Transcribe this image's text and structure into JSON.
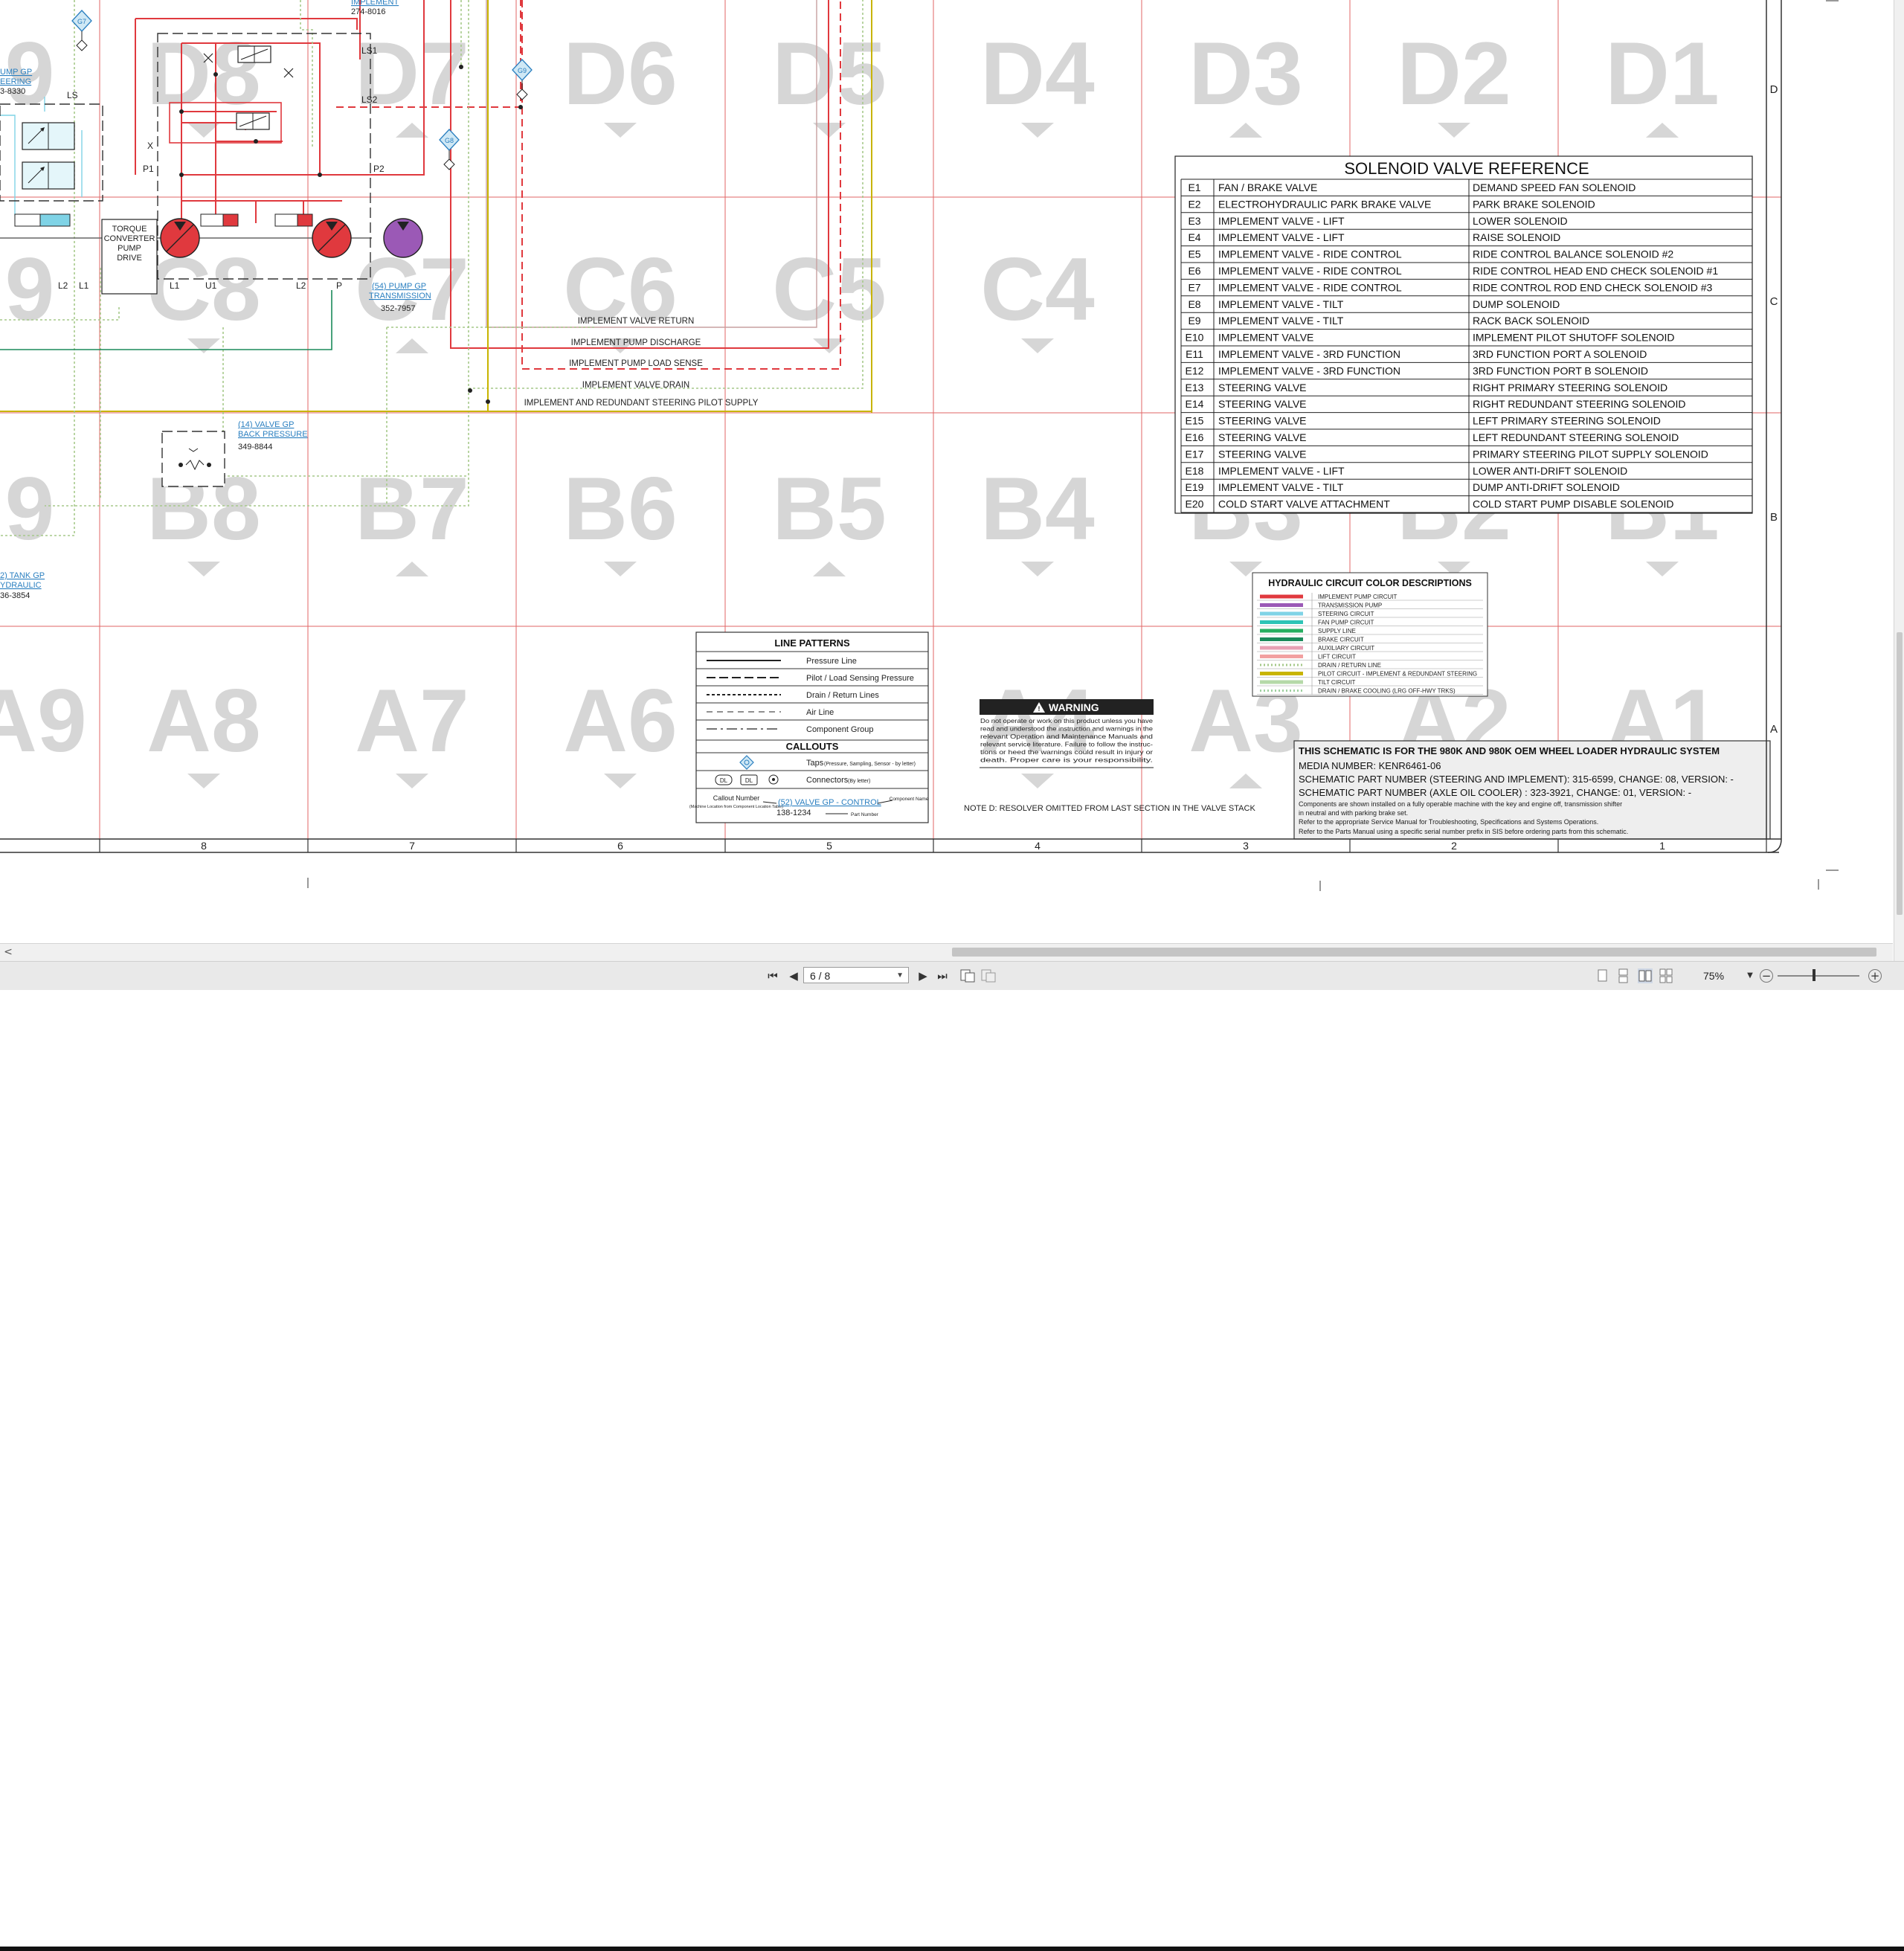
{
  "grid": {
    "zones_d": [
      "D8",
      "D7",
      "D6",
      "D5",
      "D4",
      "D3",
      "D2",
      "D1"
    ],
    "zones_c": [
      "C8",
      "C7",
      "C6",
      "C5",
      "C4",
      "C3",
      "C2",
      "C1"
    ],
    "zones_b": [
      "B8",
      "B7",
      "B6",
      "B5",
      "B4",
      "B3",
      "B2",
      "B1"
    ],
    "zones_a": [
      "A8",
      "A7",
      "A6",
      "A5",
      "A4",
      "A3",
      "A2",
      "A1"
    ],
    "partial_zone_left": [
      "9",
      "9",
      "9",
      "A9"
    ],
    "column_numbers": [
      "8",
      "7",
      "6",
      "5",
      "4",
      "3",
      "2",
      "1"
    ],
    "row_letters": [
      "D",
      "C",
      "B",
      "A"
    ]
  },
  "components": {
    "implement_link": "IMPLEMENT",
    "implement_part": "274-8016",
    "pump_steering_link_1": "UMP GP",
    "pump_steering_link_2": "EERING",
    "pump_steering_part": "3-8330",
    "torque_converter": [
      "TORQUE",
      "CONVERTER",
      "PUMP",
      "DRIVE"
    ],
    "pump_transmission_link_1": "(54) PUMP GP",
    "pump_transmission_link_2": "TRANSMISSION",
    "pump_transmission_part": "352-7957",
    "valve_back_pressure_link_1": "(14) VALVE GP",
    "valve_back_pressure_link_2": "BACK PRESSURE",
    "valve_back_pressure_part": "349-8844",
    "tank_link_1": "2) TANK GP",
    "tank_link_2": "YDRAULIC",
    "tank_part": "36-3854",
    "port_labels": [
      "LS1",
      "LS2",
      "X",
      "P1",
      "P2",
      "LS",
      "L2",
      "L1",
      "U1",
      "L1",
      "L2",
      "P"
    ],
    "tap_labels": [
      "G7",
      "G9",
      "G8"
    ]
  },
  "line_labels": [
    "IMPLEMENT VALVE RETURN",
    "IMPLEMENT PUMP DISCHARGE",
    "IMPLEMENT PUMP LOAD SENSE",
    "IMPLEMENT VALVE DRAIN",
    "IMPLEMENT AND REDUNDANT STEERING PILOT SUPPLY"
  ],
  "solenoid_table": {
    "title": "SOLENOID VALVE REFERENCE",
    "rows": [
      [
        "E1",
        "FAN / BRAKE VALVE",
        "DEMAND SPEED FAN SOLENOID"
      ],
      [
        "E2",
        "ELECTROHYDRAULIC PARK BRAKE VALVE",
        "PARK BRAKE SOLENOID"
      ],
      [
        "E3",
        "IMPLEMENT VALVE - LIFT",
        "LOWER SOLENOID"
      ],
      [
        "E4",
        "IMPLEMENT VALVE - LIFT",
        "RAISE SOLENOID"
      ],
      [
        "E5",
        "IMPLEMENT VALVE - RIDE CONTROL",
        "RIDE CONTROL BALANCE SOLENOID #2"
      ],
      [
        "E6",
        "IMPLEMENT VALVE - RIDE CONTROL",
        "RIDE CONTROL HEAD END CHECK SOLENOID #1"
      ],
      [
        "E7",
        "IMPLEMENT VALVE - RIDE CONTROL",
        "RIDE CONTROL ROD END CHECK SOLENOID #3"
      ],
      [
        "E8",
        "IMPLEMENT VALVE - TILT",
        "DUMP SOLENOID"
      ],
      [
        "E9",
        "IMPLEMENT VALVE - TILT",
        "RACK BACK SOLENOID"
      ],
      [
        "E10",
        "IMPLEMENT VALVE",
        "IMPLEMENT PILOT SHUTOFF SOLENOID"
      ],
      [
        "E11",
        "IMPLEMENT VALVE - 3RD FUNCTION",
        "3RD FUNCTION PORT A SOLENOID"
      ],
      [
        "E12",
        "IMPLEMENT VALVE - 3RD FUNCTION",
        "3RD FUNCTION PORT B SOLENOID"
      ],
      [
        "E13",
        "STEERING VALVE",
        "RIGHT PRIMARY STEERING SOLENOID"
      ],
      [
        "E14",
        "STEERING VALVE",
        "RIGHT REDUNDANT STEERING SOLENOID"
      ],
      [
        "E15",
        "STEERING VALVE",
        "LEFT PRIMARY STEERING SOLENOID"
      ],
      [
        "E16",
        "STEERING VALVE",
        "LEFT REDUNDANT STEERING SOLENOID"
      ],
      [
        "E17",
        "STEERING VALVE",
        "PRIMARY STEERING PILOT SUPPLY SOLENOID"
      ],
      [
        "E18",
        "IMPLEMENT VALVE - LIFT",
        "LOWER ANTI-DRIFT SOLENOID"
      ],
      [
        "E19",
        "IMPLEMENT VALVE - TILT",
        "DUMP ANTI-DRIFT SOLENOID"
      ],
      [
        "E20",
        "COLD START VALVE ATTACHMENT",
        "COLD START PUMP DISABLE SOLENOID"
      ]
    ]
  },
  "color_legend": {
    "title": "HYDRAULIC CIRCUIT COLOR DESCRIPTIONS",
    "items": [
      {
        "label": "IMPLEMENT PUMP CIRCUIT",
        "color": "#e0393e",
        "dotted": false
      },
      {
        "label": "TRANSMISSION PUMP",
        "color": "#9b59b6",
        "dotted": false
      },
      {
        "label": "STEERING CIRCUIT",
        "color": "#7fd3e6",
        "dotted": false
      },
      {
        "label": "FAN PUMP CIRCUIT",
        "color": "#2ec4b6",
        "dotted": false
      },
      {
        "label": "SUPPLY LINE",
        "color": "#27ae60",
        "dotted": false
      },
      {
        "label": "BRAKE CIRCUIT",
        "color": "#1b8a5a",
        "dotted": false
      },
      {
        "label": "AUXILIARY CIRCUIT",
        "color": "#e8a0b4",
        "dotted": false
      },
      {
        "label": "LIFT CIRCUIT",
        "color": "#f2a0a0",
        "dotted": false
      },
      {
        "label": "DRAIN / RETURN LINE",
        "color": "#a6c98a",
        "dotted": true
      },
      {
        "label": "PILOT CIRCUIT - IMPLEMENT & REDUNDANT STEERING",
        "color": "#c8b400",
        "dotted": false
      },
      {
        "label": "TILT CIRCUIT",
        "color": "#b5d9a8",
        "dotted": false
      },
      {
        "label": "DRAIN / BRAKE COOLING (LRG OFF-HWY TRKS)",
        "color": "#9fd0a0",
        "dotted": true
      }
    ]
  },
  "line_patterns": {
    "title": "LINE PATTERNS",
    "items": [
      "Pressure Line",
      "Pilot / Load Sensing Pressure",
      "Drain / Return Lines",
      "Air Line",
      "Component Group"
    ],
    "callouts_title": "CALLOUTS",
    "taps_label": "Taps",
    "taps_note": "(Pressure, Sampling, Sensor - by letter)",
    "connectors_label": "Connectors",
    "connectors_note": "(By letter)",
    "connector_symbols": [
      "DL",
      "DL"
    ],
    "callout_number": "Callout Number",
    "callout_note": "(Machine Location from Component Location Table)",
    "sample_link": "(52) VALVE GP - CONTROL",
    "sample_part": "138-1234",
    "component_name": "Component Name",
    "part_number": "Part Number"
  },
  "warning": {
    "title": "WARNING",
    "text": [
      "Do not operate or work on this product unless you have",
      "read and understood the instruction and warnings in the",
      "relevant Operation and Maintenance Manuals and",
      "relevant service literature. Failure to follow the instruc-",
      "tions or heed the warnings could result in injury or",
      "death. Proper care is your responsibility."
    ]
  },
  "note_d": "NOTE D: RESOLVER OMITTED FROM LAST SECTION IN THE VALVE STACK",
  "title_block": {
    "heading": "THIS SCHEMATIC IS FOR THE 980K AND 980K OEM WHEEL LOADER HYDRAULIC SYSTEM",
    "media": "MEDIA NUMBER: KENR6461-06",
    "part1": "SCHEMATIC PART NUMBER (STEERING AND IMPLEMENT): 315-6599, CHANGE: 08, VERSION: -",
    "part2": "SCHEMATIC PART NUMBER (AXLE OIL COOLER) : 323-3921, CHANGE: 01, VERSION: -",
    "note1": "Components are shown installed on a fully operable machine with the key and engine off, transmission shifter",
    "note2": "in neutral and with parking brake set.",
    "note3": "Refer to the appropriate Service Manual for Troubleshooting, Specifications and Systems Operations.",
    "note4": "Refer to the Parts Manual using a specific serial number prefix in SIS before ordering parts from this schematic."
  },
  "viewer": {
    "page_indicator": "6 / 8",
    "zoom": "75%",
    "first_page": "⏮",
    "prev_page": "◀",
    "next_page": "▶",
    "last_page": "⏭",
    "scroll_left": "<",
    "zoom_out": "−",
    "zoom_in": "+"
  }
}
